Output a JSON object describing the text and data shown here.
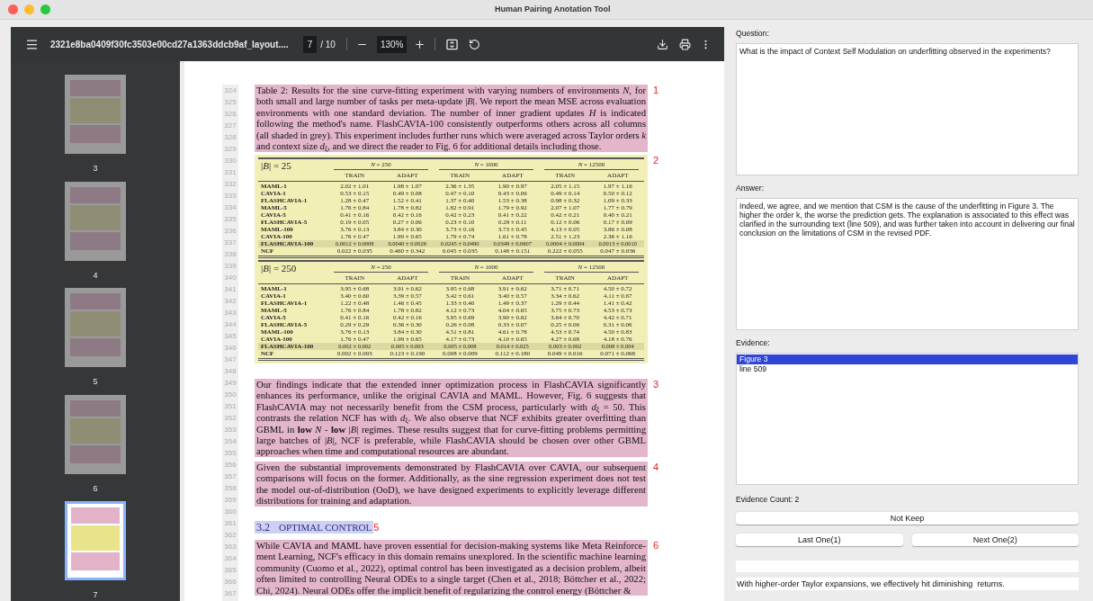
{
  "window": {
    "title": "Human Pairing Anotation Tool"
  },
  "viewer": {
    "filename": "2321e8ba0409f30fc3503e00cd27a1363ddcb9af_layout....",
    "page": "7",
    "page_count": "/ 10",
    "zoom": "130%"
  },
  "thumbnails": [
    {
      "label": "3",
      "selected": false
    },
    {
      "label": "4",
      "selected": false
    },
    {
      "label": "5",
      "selected": false
    },
    {
      "label": "6",
      "selected": false
    },
    {
      "label": "7",
      "selected": true
    }
  ],
  "line_numbers": [
    "324",
    "325",
    "326",
    "327",
    "328",
    "329",
    "330",
    "331",
    "332",
    "333",
    "334",
    "335",
    "336",
    "337",
    "338",
    "339",
    "340",
    "341",
    "342",
    "343",
    "344",
    "345",
    "346",
    "347",
    "348",
    "349",
    "350",
    "351",
    "352",
    "353",
    "354",
    "355",
    "356",
    "357",
    "358",
    "359",
    "360",
    "361",
    "362",
    "363",
    "364",
    "365",
    "366",
    "367"
  ],
  "blocks": [
    {
      "kind": "paragraph",
      "marker": "1",
      "text": "Table 2: Results for the sine curve-fitting experiment with varying numbers of environments *N*, for both small and large number of tasks per meta-update |*B*|. We report the mean MSE across evaluation environments with one standard deviation. The number of inner gradient updates *H* is indicated following the method's name. FlashCAVIA-100 consistently outperforms others across all columns (all shaded in grey). This experiment includes further runs which were averaged across Taylor orders *k* and context size *d*$_{ξ}$, and we direct the reader to Fig. 6 for additional details including those."
    },
    {
      "kind": "table",
      "marker": "2",
      "tables": [
        {
          "label": "|*B*| = 25",
          "groups": [
            "*N* = 250",
            "*N* = 1000",
            "*N* = 12500"
          ],
          "subheaders": [
            "TRAIN",
            "ADAPT",
            "TRAIN",
            "ADAPT",
            "TRAIN",
            "ADAPT"
          ],
          "rows": [
            {
              "name": "MAML-1",
              "shaded": false,
              "values": [
                "2.02 ± 1.01",
                "1.98 ± 1.07",
                "2.36 ± 1.35",
                "1.90 ± 0.97",
                "2.05 ± 1.15",
                "1.97 ± 1.16"
              ]
            },
            {
              "name": "CAVIA-1",
              "shaded": false,
              "values": [
                "0.53 ± 0.15",
                "0.49 ± 0.08",
                "0.47 ± 0.10",
                "0.43 ± 0.06",
                "0.49 ± 0.14",
                "0.50 ± 0.12"
              ]
            },
            {
              "name": "FLASHCAVIA-1",
              "shaded": false,
              "values": [
                "1.28 ± 0.47",
                "1.52 ± 0.41",
                "1.37 ± 0.40",
                "1.53 ± 0.38",
                "0.98 ± 0.32",
                "1.09 ± 0.33"
              ]
            },
            {
              "name": "MAML-5",
              "shaded": false,
              "values": [
                "1.76 ± 0.84",
                "1.78 ± 0.82",
                "1.82 ± 0.91",
                "1.79 ± 0.92",
                "2.07 ± 1.07",
                "1.77 ± 0.79"
              ]
            },
            {
              "name": "CAVIA-5",
              "shaded": false,
              "values": [
                "0.41 ± 0.16",
                "0.42 ± 0.16",
                "0.42 ± 0.23",
                "0.41 ± 0.22",
                "0.42 ± 0.21",
                "0.40 ± 0.21"
              ]
            },
            {
              "name": "FLASHCAVIA-5",
              "shaded": false,
              "values": [
                "0.19 ± 0.05",
                "0.27 ± 0.06",
                "0.23 ± 0.10",
                "0.29 ± 0.11",
                "0.12 ± 0.06",
                "0.17 ± 0.09"
              ]
            },
            {
              "name": "MAML-100",
              "shaded": false,
              "values": [
                "3.76 ± 0.13",
                "3.84 ± 0.30",
                "3.73 ± 0.16",
                "3.73 ± 0.45",
                "4.13 ± 0.05",
                "3.86 ± 0.08"
              ]
            },
            {
              "name": "CAVIA-100",
              "shaded": false,
              "values": [
                "1.76 ± 0.47",
                "1.99 ± 0.65",
                "1.79 ± 0.74",
                "1.61 ± 0.78",
                "2.51 ± 1.23",
                "2.36 ± 1.16"
              ]
            },
            {
              "name": "FLASHCAVIA-100",
              "shaded": true,
              "values": [
                "0.0012 ± 0.0008",
                "0.0040 ± 0.0026",
                "0.0245 ± 0.0490",
                "0.0349 ± 0.0607",
                "0.0004 ± 0.0004",
                "0.0013 ± 0.0010"
              ]
            },
            {
              "name": "NCF",
              "shaded": false,
              "values": [
                "0.022 ± 0.035",
                "0.460 ± 0.342",
                "0.045 ± 0.035",
                "0.148 ± 0.151",
                "0.222 ± 0.055",
                "0.047 ± 0.036"
              ]
            }
          ]
        },
        {
          "label": "|*B*| = 250",
          "groups": [
            "*N* = 250",
            "*N* = 1000",
            "*N* = 12500"
          ],
          "subheaders": [
            "TRAIN",
            "ADAPT",
            "TRAIN",
            "ADAPT",
            "TRAIN",
            "ADAPT"
          ],
          "rows": [
            {
              "name": "MAML-1",
              "shaded": false,
              "values": [
                "3.95 ± 0.68",
                "3.91 ± 0.62",
                "3.95 ± 0.68",
                "3.91 ± 0.62",
                "3.71 ± 0.71",
                "4.50 ± 0.72"
              ]
            },
            {
              "name": "CAVIA-1",
              "shaded": false,
              "values": [
                "3.40 ± 0.60",
                "3.39 ± 0.57",
                "3.42 ± 0.61",
                "3.40 ± 0.57",
                "3.34 ± 0.62",
                "4.11 ± 0.67"
              ]
            },
            {
              "name": "FLASHCAVIA-1",
              "shaded": false,
              "values": [
                "1.22 ± 0.48",
                "1.46 ± 0.45",
                "1.33 ± 0.40",
                "1.49 ± 0.37",
                "1.29 ± 0.44",
                "1.41 ± 0.42"
              ]
            },
            {
              "name": "MAML-5",
              "shaded": false,
              "values": [
                "1.76 ± 0.84",
                "1.78 ± 0.82",
                "4.12 ± 0.73",
                "4.04 ± 0.65",
                "3.75 ± 0.73",
                "4.53 ± 0.73"
              ]
            },
            {
              "name": "CAVIA-5",
              "shaded": false,
              "values": [
                "0.41 ± 0.16",
                "0.42 ± 0.16",
                "3.95 ± 0.69",
                "3.90 ± 0.62",
                "3.64 ± 0.70",
                "4.42 ± 0.71"
              ]
            },
            {
              "name": "FLASHCAVIA-5",
              "shaded": false,
              "values": [
                "0.29 ± 0.29",
                "0.36 ± 0.30",
                "0.26 ± 0.08",
                "0.33 ± 0.07",
                "0.25 ± 0.06",
                "0.31 ± 0.06"
              ]
            },
            {
              "name": "MAML-100",
              "shaded": false,
              "values": [
                "3.76 ± 0.13",
                "3.84 ± 0.30",
                "4.51 ± 0.81",
                "4.61 ± 0.78",
                "4.53 ± 0.74",
                "4.50 ± 0.83"
              ]
            },
            {
              "name": "CAVIA-100",
              "shaded": false,
              "values": [
                "1.76 ± 0.47",
                "1.99 ± 0.65",
                "4.17 ± 0.73",
                "4.10 ± 0.65",
                "4.27 ± 0.68",
                "4.18 ± 0.76"
              ]
            },
            {
              "name": "FLASHCAVIA-100",
              "shaded": true,
              "values": [
                "0.002 ± 0.002",
                "0.005 ± 0.003",
                "0.005 ± 0.008",
                "0.014 ± 0.025",
                "0.003 ± 0.002",
                "0.008 ± 0.004"
              ]
            },
            {
              "name": "NCF",
              "shaded": false,
              "values": [
                "0.002 ± 0.003",
                "0.123 ± 0.190",
                "0.008 ± 0.009",
                "0.112 ± 0.180",
                "0.049 ± 0.016",
                "0.071 ± 0.068"
              ]
            }
          ]
        }
      ]
    },
    {
      "kind": "paragraph",
      "marker": "3",
      "text": "Our findings indicate that the extended inner optimization process in FlashCAVIA significantly enhances its performance, unlike the original CAVIA and MAML. However, Fig. 6 suggests that FlashCAVIA may not necessarily benefit from the CSM process, particularly with *d*$_{ξ}$ = 50. This contrasts the relation NCF has with *d*$_{ξ}$. We also observe that NCF exhibits greater overfitting than GBML in **low** *N* - **low** |*B*| regimes. These results suggest that for curve-fitting problems permitting large batches of |*B*|, NCF is preferable, while FlashCAVIA should be chosen over other GBML approaches when time and computational resources are abundant."
    },
    {
      "kind": "paragraph",
      "marker": "4",
      "text": "Given the substantial improvements demonstrated by FlashCAVIA over CAVIA, our subsequent comparisons will focus on the former. Additionally, as the sine regression experiment does not test the model out-of-distribution (OoD), we have designed experiments to explicitly leverage different distributions for training and adaptation."
    },
    {
      "kind": "heading",
      "marker": "5",
      "number": "3.2",
      "title": "OPTIMAL CONTROL"
    },
    {
      "kind": "paragraph",
      "marker": "6",
      "text": "While CAVIA and MAML have proven essential for decision-making systems like Meta Reinforce-ment Learning, NCF's efficacy in this domain remains unexplored. In the scientific machine learning community (Cuomo et al., 2022), optimal control has been investigated as a decision problem, albeit often limited to controlling Neural ODEs to a single target (Chen et al., 2018; Böttcher et al., 2022; Chi, 2024). Neural ODEs offer the implicit benefit of regularizing the control energy (Böttcher &"
    }
  ],
  "panel": {
    "question_label": "Question:",
    "question": "What is the impact of Context Self Modulation on underfitting observed in the experiments?",
    "answer_label": "Answer:",
    "answer": "Indeed, we agree, and we mention that CSM is the cause of the underfitting in Figure 3. The higher the order k, the worse the prediction gets. The explanation is associated to this effect was clarified in the surrounding text (line 509), and was further taken into account in delivering our final conclusion on the limitations of CSM in the revised PDF.",
    "evidence_label": "Evidence:",
    "evidence": [
      {
        "text": "Figure 3",
        "selected": true
      },
      {
        "text": "line 509",
        "selected": false
      }
    ],
    "evidence_count": "Evidence Count: 2",
    "not_keep": "Not Keep",
    "last": "Last One(1)",
    "next": "Next One(2)",
    "summary": "With higher-order Taylor expansions, we effectively hit diminishing  returns."
  }
}
